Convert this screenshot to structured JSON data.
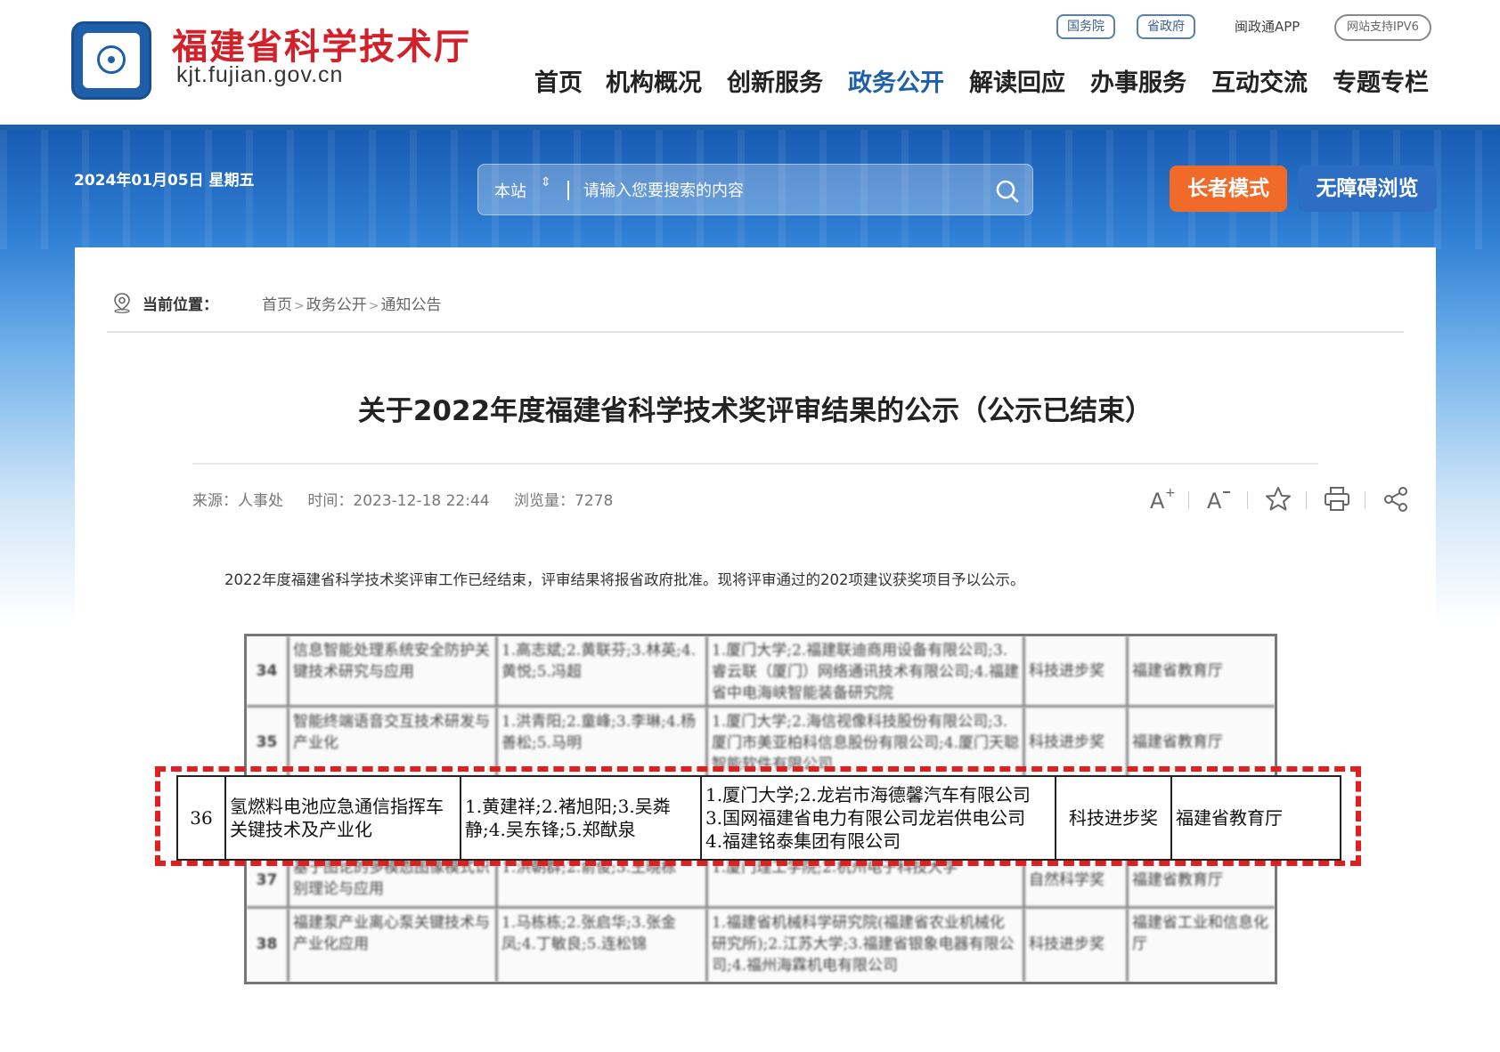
{
  "header": {
    "site_title": "福建省科学技术厅",
    "site_domain": "kjt.fujian.gov.cn",
    "top_links": [
      "国务院",
      "省政府",
      "闽政通APP",
      "网站支持IPV6"
    ],
    "nav": [
      "首页",
      "机构概况",
      "创新服务",
      "政务公开",
      "解读回应",
      "办事服务",
      "互动交流",
      "专题专栏"
    ],
    "nav_active": "政务公开",
    "brand_color": "#1f5fa9",
    "title_color": "#d3212b"
  },
  "banner": {
    "date": "2024年01月05日 星期五",
    "search_scope": "本站",
    "search_placeholder": "请输入您要搜索的内容",
    "elder_mode": "长者模式",
    "accessible": "无障碍浏览"
  },
  "breadcrumb": {
    "label": "当前位置：",
    "items": [
      "首页",
      "政务公开",
      "通知公告"
    ]
  },
  "article": {
    "title": "关于2022年度福建省科学技术奖评审结果的公示（公示已结束）",
    "source": "来源：人事处",
    "time": "时间：2023-12-18 22:44",
    "views": "浏览量：7278",
    "intro": "2022年度福建省科学技术奖评审工作已经结束，评审结果将报省政府批准。现将评审通过的202项建议获奖项目予以公示。"
  },
  "tools": [
    "font-increase-icon",
    "font-decrease-icon",
    "star-icon",
    "print-icon",
    "share-icon"
  ],
  "table_rows": [
    {
      "no": "34",
      "project": "信息智能处理系统安全防护关键技术研究与应用",
      "people": "1.高志斌;2.黄联芬;3.林英;4.黄悦;5.冯超",
      "units": "1.厦门大学;2.福建联迪商用设备有限公司;3.睿云联（厦门）网络通讯技术有限公司;4.福建省中电海峡智能装备研究院",
      "award": "科技进步奖",
      "nominator": "福建省教育厅"
    },
    {
      "no": "35",
      "project": "智能终端语音交互技术研发与产业化",
      "people": "1.洪青阳;2.童峰;3.李琳;4.杨善松;5.马明",
      "units": "1.厦门大学;2.海信视像科技股份有限公司;3.厦门市美亚柏科信息股份有限公司;4.厦门天聪智能软件有限公司",
      "award": "科技进步奖",
      "nominator": "福建省教育厅"
    },
    {
      "no": "37",
      "project": "基于图论的多模态图像模式识别理论与应用",
      "people": "1.洪朝群;2.俞俊;3.王晓栋",
      "units": "1.厦门理工学院;2.杭州电子科技大学",
      "award": "自然科学奖",
      "nominator": "福建省教育厅"
    },
    {
      "no": "38",
      "project": "福建泵产业离心泵关键技术与产业化应用",
      "people": "1.马栋栋;2.张启华;3.张金凤;4.丁敏良;5.连松锦",
      "units": "1.福建省机械科学研究院(福建省农业机械化研究所);2.江苏大学;3.福建省银象电器有限公司;4.福州海霖机电有限公司",
      "award": "科技进步奖",
      "nominator": "福建省工业和信息化厅"
    }
  ],
  "highlight_row": {
    "no": "36",
    "project_lines": [
      "氢燃料电池应急通信指挥车",
      "关键技术及产业化"
    ],
    "people_lines": [
      "1.黄建祥;2.褚旭阳;3.吴粦",
      "静;4.吴东锋;5.郑猷泉"
    ],
    "units_lines": [
      "1.厦门大学;2.龙岩市海德馨汽车有限公司",
      "3.国网福建省电力有限公司龙岩供电公司",
      "4.福建铭泰集团有限公司"
    ],
    "award": "科技进步奖",
    "nominator": "福建省教育厅",
    "frame_color": "#e02020"
  }
}
